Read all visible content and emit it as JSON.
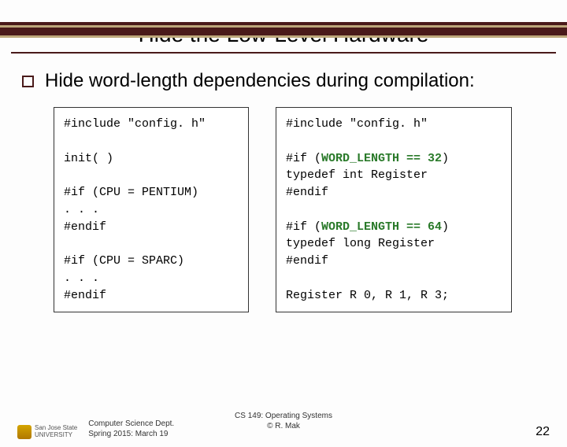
{
  "title": "Hide the Low-Level Hardware",
  "lead": "Hide word-length dependencies during compilation:",
  "code_left": {
    "l1": "#include \"config. h\"",
    "l2": "",
    "l3": "init( )",
    "l4": "",
    "l5": "#if (CPU = PENTIUM)",
    "l6": ". . .",
    "l7": "#endif",
    "l8": "",
    "l9": "#if (CPU = SPARC)",
    "l10": ". . .",
    "l11": "#endif"
  },
  "code_right": {
    "l1": "#include \"config. h\"",
    "l2": "",
    "l3a": "#if (",
    "l3b": "WORD_LENGTH == 32",
    "l3c": ")",
    "l4": "typedef int Register",
    "l5": "#endif",
    "l6": "",
    "l7a": "#if (",
    "l7b": "WORD_LENGTH == 64",
    "l7c": ")",
    "l8": "typedef long Register",
    "l9": "#endif",
    "l10": "",
    "l11": "Register R 0, R 1, R 3;"
  },
  "footer": {
    "inst1": "San Jose State",
    "inst2": "UNIVERSITY",
    "dept": "Computer Science Dept.",
    "term": "Spring 2015: March 19",
    "course": "CS 149: Operating Systems",
    "author": "© R. Mak",
    "page": "22"
  }
}
